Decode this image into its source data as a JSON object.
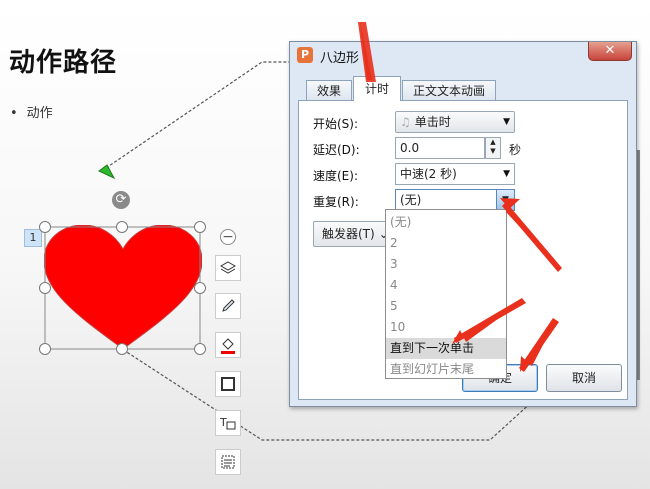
{
  "slide": {
    "title": "动作路径",
    "bullet": "动作",
    "animation_number": "1"
  },
  "dialog": {
    "app_icon_letter": "P",
    "title": "八边形",
    "close_symbol": "✕",
    "tabs": [
      "效果",
      "计时",
      "正文文本动画"
    ],
    "active_tab": "计时",
    "fields": {
      "start_label": "开始(S):",
      "start_value": "单击时",
      "delay_label": "延迟(D):",
      "delay_value": "0.0",
      "delay_unit": "秒",
      "speed_label": "速度(E):",
      "speed_value": "中速(2 秒)",
      "repeat_label": "重复(R):",
      "repeat_value": "(无)"
    },
    "trigger_button": "触发器(T)",
    "ok_button": "确定",
    "cancel_button": "取消"
  },
  "repeat_dropdown": {
    "options": [
      "(无)",
      "2",
      "3",
      "4",
      "5",
      "10",
      "直到下一次单击",
      "直到幻灯片末尾"
    ],
    "highlighted": "直到下一次单击"
  },
  "colors": {
    "heart": "#ff0000",
    "heart_outline": "#c83c3c",
    "arrow_annotation": "#e8301c",
    "path_start_marker": "#2eb82e",
    "accent": "#3d7ab8"
  }
}
